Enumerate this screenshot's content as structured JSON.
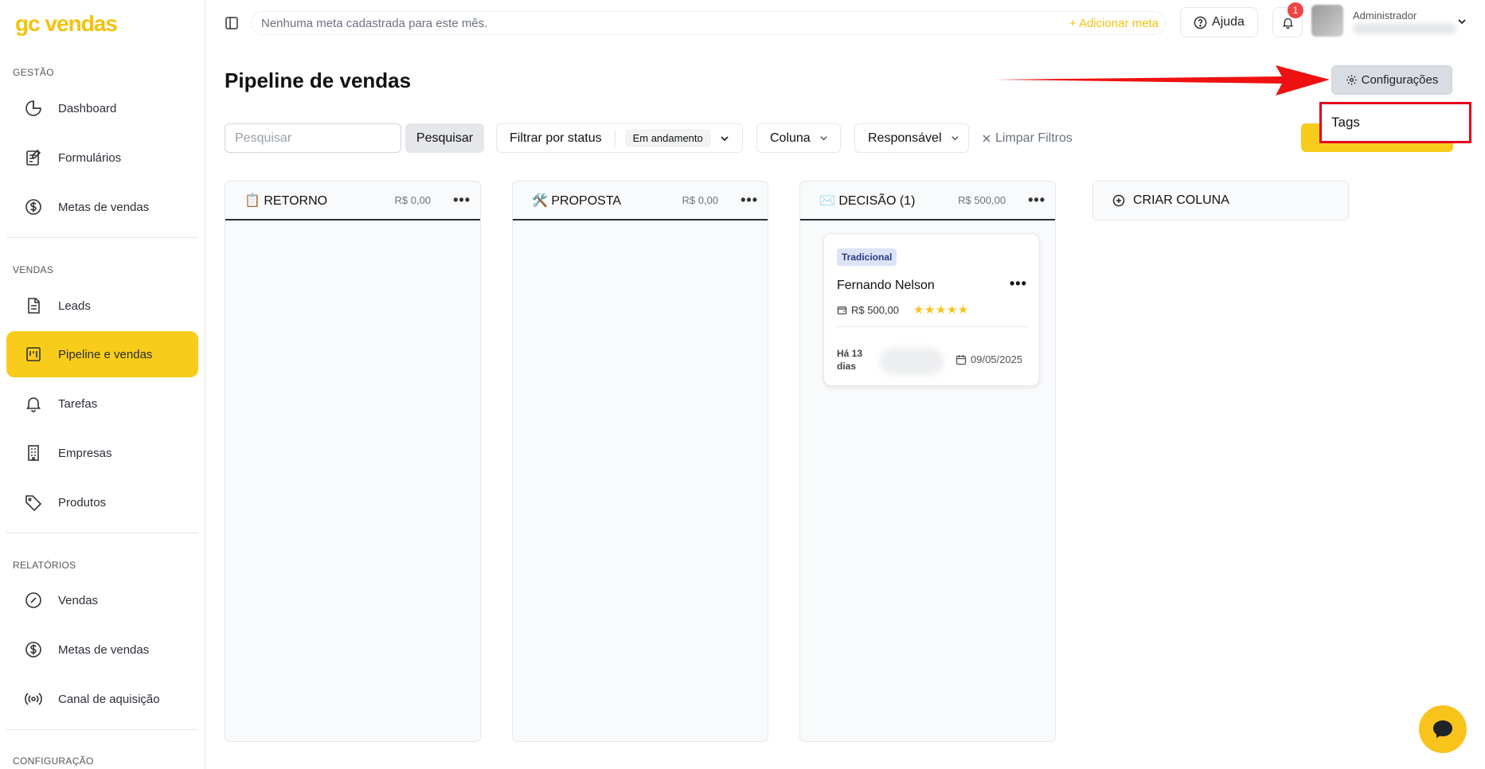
{
  "brand": {
    "logo_text": "gc vendas",
    "accent_color": "#f8cc1b"
  },
  "sidebar": {
    "sections": [
      {
        "label": "GESTÃO",
        "items": [
          {
            "label": "Dashboard",
            "icon": "pie-chart-icon"
          },
          {
            "label": "Formulários",
            "icon": "form-icon"
          },
          {
            "label": "Metas de vendas",
            "icon": "dollar-circle-icon"
          }
        ]
      },
      {
        "label": "VENDAS",
        "items": [
          {
            "label": "Leads",
            "icon": "document-icon"
          },
          {
            "label": "Pipeline e vendas",
            "icon": "kanban-icon",
            "active": true
          },
          {
            "label": "Tarefas",
            "icon": "bell-icon"
          },
          {
            "label": "Empresas",
            "icon": "building-icon"
          },
          {
            "label": "Produtos",
            "icon": "tag-icon"
          }
        ]
      },
      {
        "label": "RELATÓRIOS",
        "items": [
          {
            "label": "Vendas",
            "icon": "gauge-icon"
          },
          {
            "label": "Metas de vendas",
            "icon": "dollar-circle-icon"
          },
          {
            "label": "Canal de aquisição",
            "icon": "broadcast-icon"
          }
        ]
      },
      {
        "label": "CONFIGURAÇÃO",
        "items": []
      }
    ]
  },
  "topbar": {
    "goal_text": "Nenhuma meta cadastrada para este mês.",
    "add_goal": "+ Adicionar meta",
    "help_label": "Ajuda",
    "notification_count": "1",
    "user_role": "Administrador"
  },
  "page": {
    "title": "Pipeline de vendas",
    "config_label": "Configurações",
    "config_menu": [
      "Tags"
    ]
  },
  "filters": {
    "search_placeholder": "Pesquisar",
    "search_button": "Pesquisar",
    "status_label": "Filtrar por status",
    "status_value": "Em andamento",
    "column_label": "Coluna",
    "responsible_label": "Responsável",
    "clear_label": "Limpar Filtros"
  },
  "columns": [
    {
      "emoji": "📋",
      "title": "RETORNO",
      "total": "R$ 0,00"
    },
    {
      "emoji": "🛠️",
      "title": "PROPOSTA",
      "total": "R$ 0,00"
    },
    {
      "emoji": "✉️",
      "title": "DECISÃO (1)",
      "total": "R$ 500,00"
    }
  ],
  "new_column_label": "CRIAR COLUNA",
  "card": {
    "tag": "Tradicional",
    "name": "Fernando Nelson",
    "value": "R$ 500,00",
    "rating": 5,
    "age_line1": "Há 13",
    "age_line2": "dias",
    "date": "09/05/2025"
  }
}
